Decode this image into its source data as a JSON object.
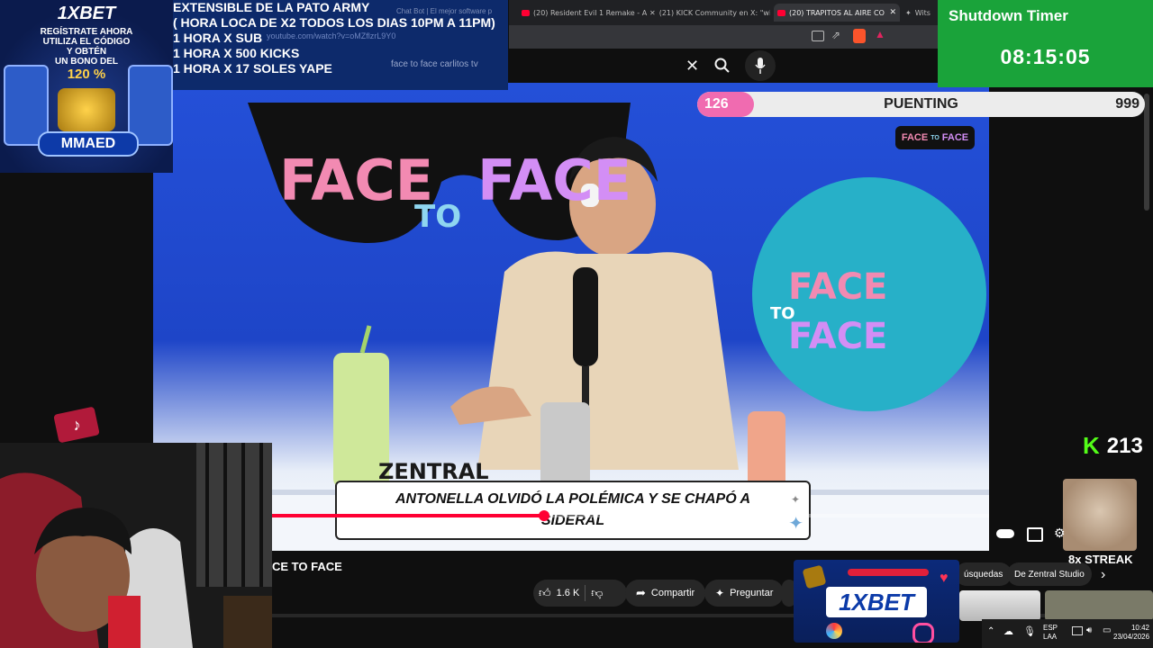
{
  "browser": {
    "tabs": [
      {
        "title": "(20) Resident Evil 1 Remake - A"
      },
      {
        "title": "(21) KICK Community en X: \"wi"
      },
      {
        "title": "(20) TRAPITOS AL AIRE CO"
      },
      {
        "title": "Wits"
      }
    ],
    "url": "youtube.com/watch?v=oMZflzrL9Y0"
  },
  "youtube": {
    "search_query": "face to face carlitos tv",
    "video_title": "CE TO FACE",
    "likes": "1.6 K",
    "share_label": "Compartir",
    "ask_label": "Preguntar",
    "chips": [
      "úsquedas",
      "De Zentral Studio"
    ]
  },
  "overlay_info": {
    "lines": [
      "EXTENSIBLE  DE LA PATO ARMY",
      "( HORA LOCA DE X2 TODOS LOS DIAS 10PM A 11PM)",
      "1 HORA X SUB",
      "1 HORA X 500 KICKS",
      "1 HORA X 17 SOLES YAPE"
    ],
    "chatbot_tab": "Chat Bot | El mejor software p"
  },
  "ad_left": {
    "brand": "1XBET",
    "lines": [
      "REGÍSTRATE AHORA",
      "UTILIZA EL CÓDIGO",
      "Y OBTÉN",
      "UN BONO DEL"
    ],
    "bonus": "120 %",
    "code": "MMAED"
  },
  "timer": {
    "label": "Shutdown Timer",
    "value": "08:15:05"
  },
  "goal": {
    "current": "126",
    "name": "PUENTING",
    "target": "999",
    "progress": 0.126
  },
  "kicks": {
    "count": "213",
    "streak": "8x STREAK"
  },
  "video": {
    "caption": "ANTONELLA OLVIDÓ LA POLÉMICA Y SE CHAPÓ A SIDERAL",
    "logo_word1": "FACE",
    "logo_word2": "TO",
    "logo_word3": "FACE",
    "desk_brand": "ZENTRAL",
    "played_fraction": 0.38
  },
  "ad_bottom": {
    "brand": "1XBET"
  },
  "taskbar": {
    "lang": "ESP",
    "layout": "LAA",
    "time": "10:42",
    "date": "23/04/2026"
  },
  "colors": {
    "timer_green": "#1aa33a",
    "goal_pink": "#f06bb0",
    "kick_green": "#53fc18",
    "yt_red": "#ff0033"
  }
}
